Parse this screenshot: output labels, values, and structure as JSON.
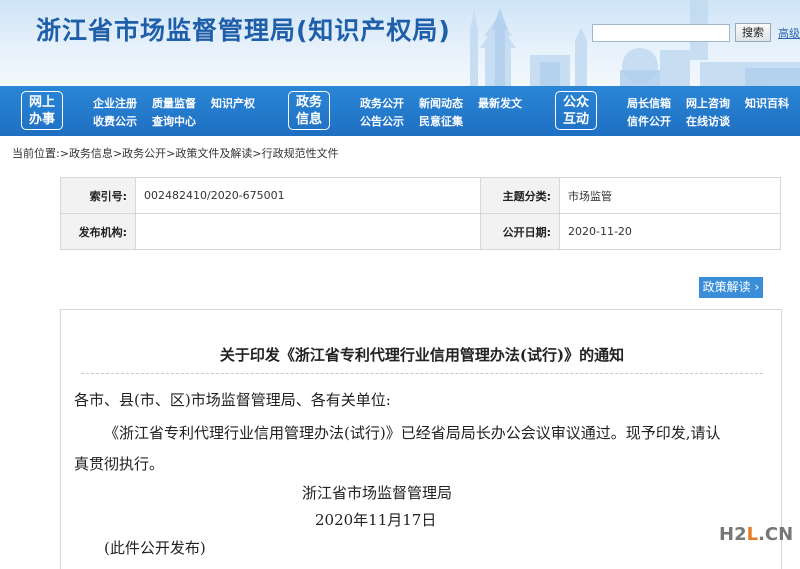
{
  "header": {
    "title": "浙江省市场监督管理局(知识产权局)",
    "search": {
      "value": "",
      "button_label": "搜索"
    },
    "advanced_search_label": "高级"
  },
  "nav": {
    "categories": [
      {
        "label_line1": "网上",
        "label_line2": "办事",
        "links": [
          "企业注册",
          "质量监督",
          "知识产权",
          "收费公示",
          "查询中心"
        ]
      },
      {
        "label_line1": "政务",
        "label_line2": "信息",
        "links": [
          "政务公开",
          "新闻动态",
          "最新发文",
          "公告公示",
          "民意征集"
        ]
      },
      {
        "label_line1": "公众",
        "label_line2": "互动",
        "links": [
          "局长信箱",
          "网上咨询",
          "知识百科",
          "信件公开",
          "在线访谈"
        ]
      }
    ]
  },
  "breadcrumb": {
    "prefix": "当前位置:",
    "items": [
      "政务信息",
      "政务公开",
      "政策文件及解读",
      "行政规范性文件"
    ],
    "separator": ">"
  },
  "meta": {
    "index_label": "索引号:",
    "index_value": "002482410/2020-675001",
    "topic_label": "主题分类:",
    "topic_value": "市场监管",
    "publisher_label": "发布机构:",
    "publisher_value": "",
    "date_label": "公开日期:",
    "date_value": "2020-11-20"
  },
  "policy_button_label": "政策解读",
  "policy_button_arrow": "›",
  "document": {
    "title": "关于印发《浙江省专利代理行业信用管理办法(试行)》的通知",
    "salutation": "各市、县(市、区)市场监督管理局、各有关单位:",
    "body_line1": "《浙江省专利代理行业信用管理办法(试行)》已经省局局长办公会议审议通过。现予印发,请认",
    "body_line2": "真贯彻执行。",
    "signature": "浙江省市场监督管理局",
    "date": "2020年11月17日",
    "note": "(此件公开发布)"
  },
  "watermark": {
    "part1": "H2",
    "part2": "L",
    "part3": ".CN"
  }
}
